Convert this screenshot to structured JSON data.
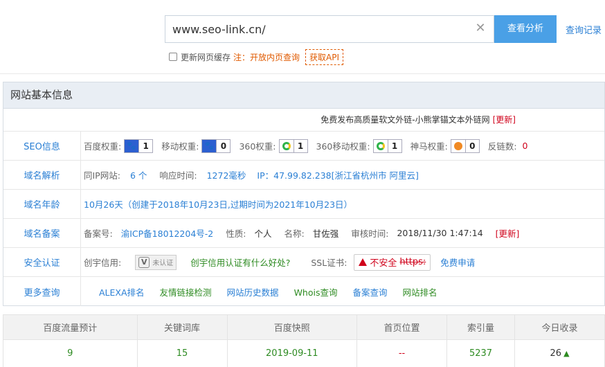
{
  "search": {
    "value": "www.seo-link.cn/",
    "button": "查看分析",
    "history": "查询记录"
  },
  "options": {
    "cache_label": "更新网页缓存",
    "note": "注：开放内页查询",
    "api": "获取API"
  },
  "panel": {
    "title": "网站基本信息",
    "promo": "免费发布高质量软文外链-小熊掌锚文本外链网",
    "promo_update": "[更新]",
    "seo": {
      "label": "SEO信息",
      "baidu_label": "百度权重:",
      "baidu_value": "1",
      "mobile_label": "移动权重:",
      "mobile_value": "0",
      "s360_label": "360权重:",
      "s360_value": "1",
      "s360m_label": "360移动权重:",
      "s360m_value": "1",
      "shenma_label": "神马权重:",
      "shenma_value": "0",
      "backlinks_label": "反链数:",
      "backlinks_value": "0"
    },
    "dns": {
      "label": "域名解析",
      "sameip_label": "同IP网站:",
      "sameip_value": "6 个",
      "resp_label": "响应时间:",
      "resp_value": "1272毫秒",
      "ip_text": "IP：47.99.82.238[浙江省杭州市 阿里云]"
    },
    "age": {
      "label": "域名年龄",
      "text": "10月26天（创建于2018年10月23日,过期时间为2021年10月23日）"
    },
    "icp": {
      "label": "域名备案",
      "no_label": "备案号:",
      "no_value": "渝ICP备18012204号-2",
      "type_label": "性质:",
      "type_value": "个人",
      "name_label": "名称:",
      "name_value": "甘佐强",
      "time_label": "审核时间:",
      "time_value": "2018/11/30 1:47:14",
      "update": "[更新]"
    },
    "security": {
      "label": "安全认证",
      "cx_label": "创宇信用:",
      "cx_badge": "未认证",
      "cx_link": "创宇信用认证有什么好处?",
      "ssl_label": "SSL证书:",
      "ssl_text": "不安全",
      "ssl_https": "https:",
      "ssl_apply": "免费申请"
    },
    "more": {
      "label": "更多查询",
      "links": [
        "ALEXA排名",
        "友情链接检测",
        "网站历史数据",
        "Whois查询",
        "备案查询",
        "网站排名"
      ]
    }
  },
  "stats": {
    "headers": [
      "百度流量预计",
      "关键词库",
      "百度快照",
      "首页位置",
      "索引量",
      "今日收录"
    ],
    "values": [
      "9",
      "15",
      "2019-09-11",
      "--",
      "5237",
      "26"
    ]
  }
}
